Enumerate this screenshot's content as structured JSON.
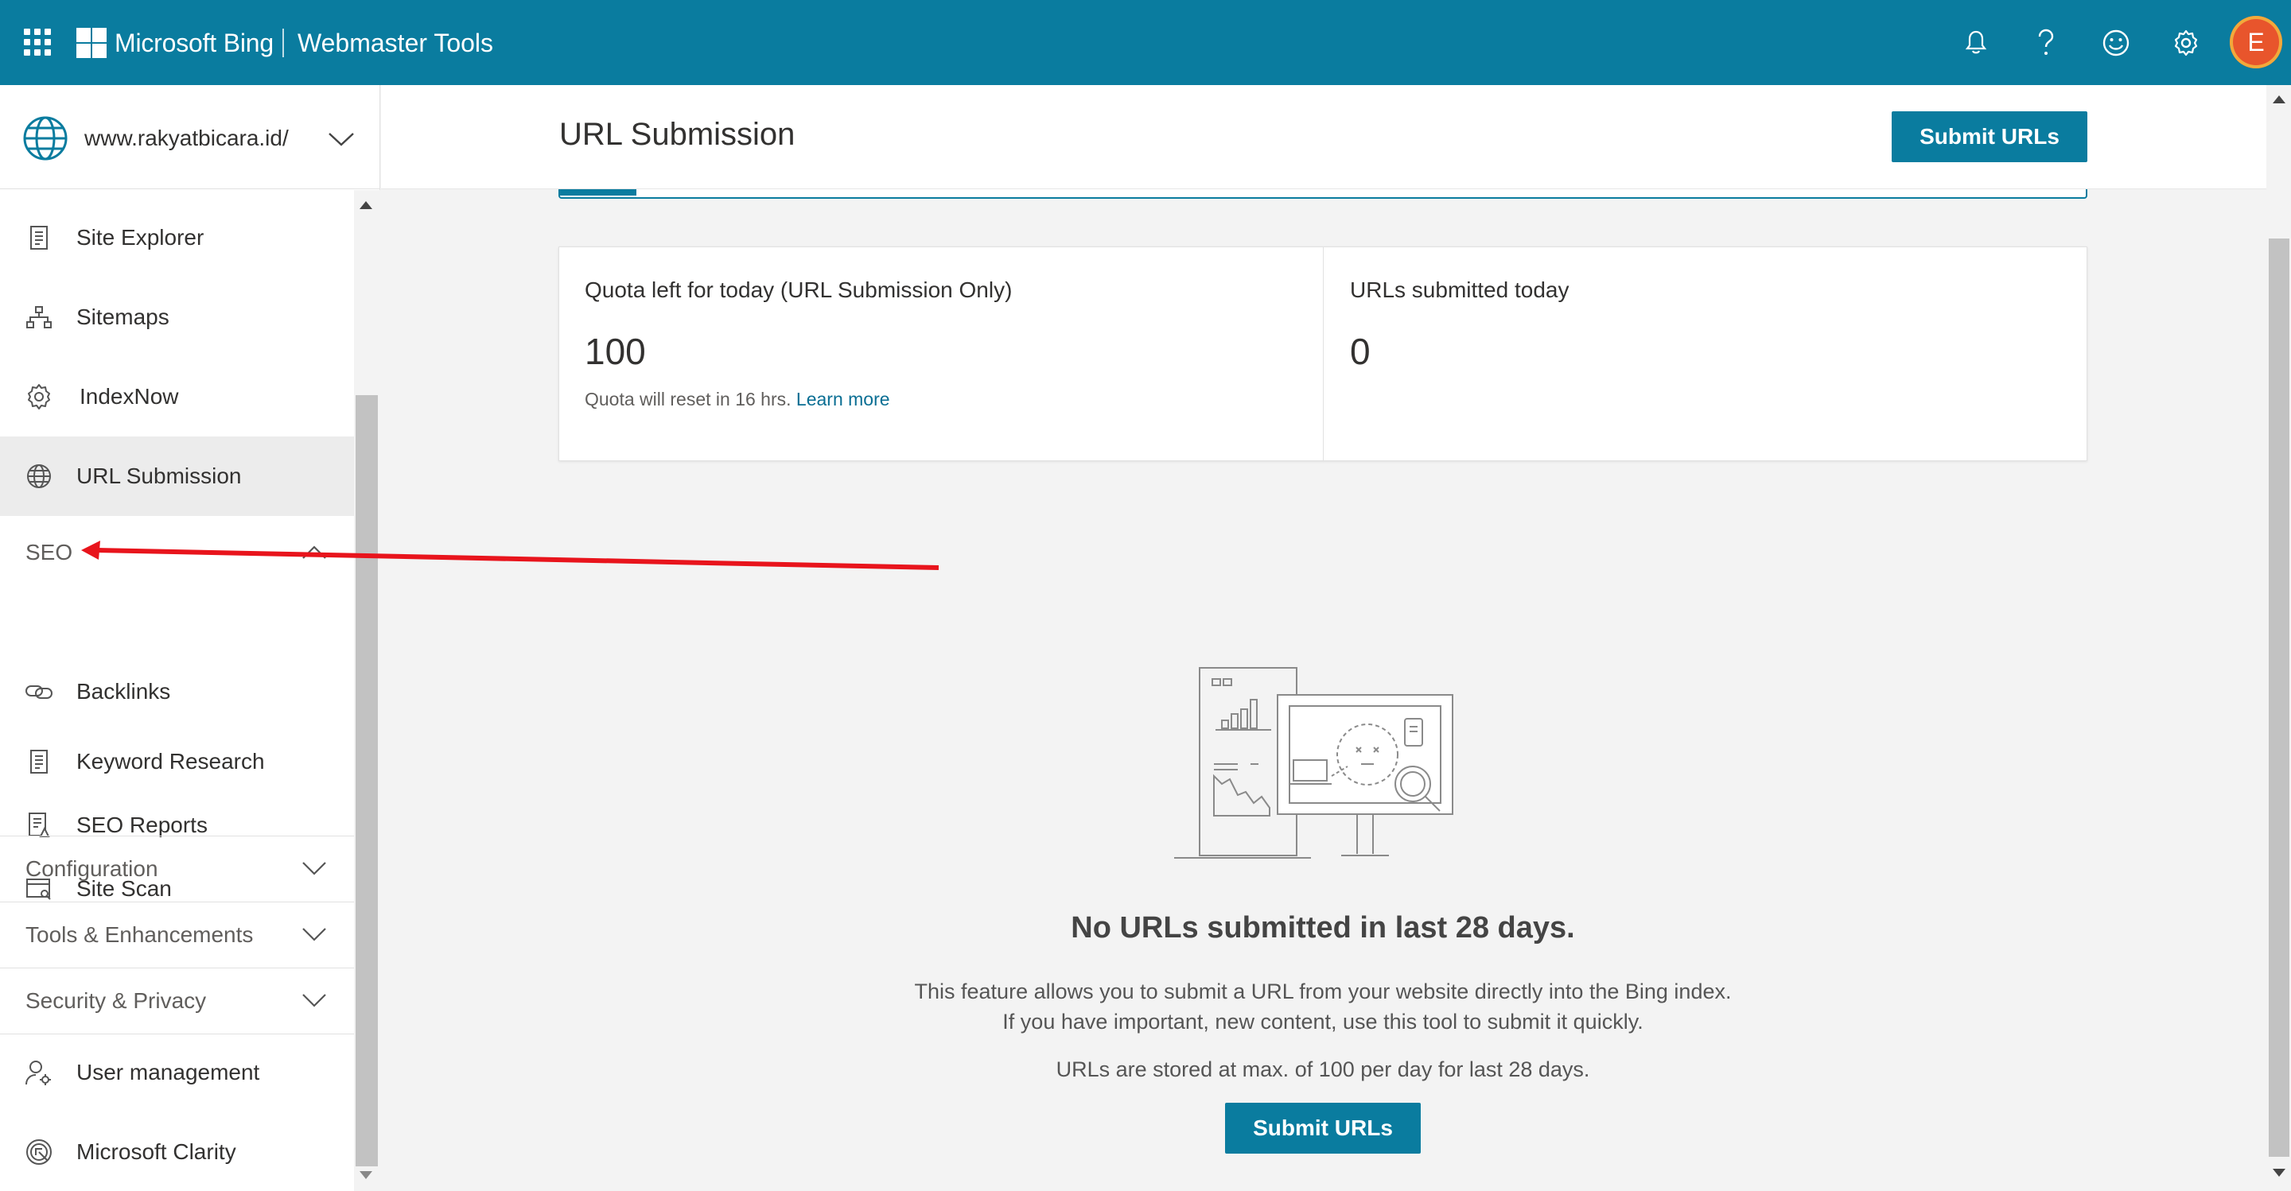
{
  "header": {
    "brand": "Microsoft Bing",
    "product": "Webmaster Tools",
    "avatar_initial": "E",
    "icons": [
      "notification-bell-icon",
      "help-icon",
      "feedback-smiley-icon",
      "settings-gear-icon"
    ],
    "bar_color": "#0a7c9f"
  },
  "site": {
    "url": "www.rakyatbicara.id/"
  },
  "nav": {
    "items_top": [
      {
        "label": "Site Explorer",
        "icon": "site-explorer-icon"
      },
      {
        "label": "Sitemaps",
        "icon": "sitemap-icon"
      },
      {
        "label": "IndexNow",
        "icon": "gear-icon"
      },
      {
        "label": "URL Submission",
        "icon": "globe-icon",
        "active": true
      }
    ],
    "seo_section": {
      "label": "SEO",
      "items": [
        {
          "label": "Backlinks",
          "icon": "link-icon"
        },
        {
          "label": "Keyword Research",
          "icon": "document-icon"
        },
        {
          "label": "SEO Reports",
          "icon": "report-icon"
        },
        {
          "label": "Site Scan",
          "icon": "site-scan-icon"
        }
      ]
    },
    "collapsed_sections": [
      {
        "label": "Configuration"
      },
      {
        "label": "Tools & Enhancements"
      },
      {
        "label": "Security & Privacy"
      }
    ],
    "items_bottom": [
      {
        "label": "User management",
        "icon": "user-management-icon"
      },
      {
        "label": "Microsoft Clarity",
        "icon": "clarity-icon"
      }
    ]
  },
  "main": {
    "title": "URL Submission",
    "submit_button": "Submit URLs",
    "quota_card": {
      "label": "Quota left for today (URL Submission Only)",
      "value": "100",
      "note": "Quota will reset in 16 hrs.",
      "link": "Learn more"
    },
    "submitted_card": {
      "label": "URLs submitted today",
      "value": "0"
    },
    "empty_state": {
      "title": "No URLs submitted in last 28 days.",
      "line1": "This feature allows you to submit a URL from your website directly into the Bing index.",
      "line2": "If you have important, new content, use this tool to submit it quickly.",
      "line3": "URLs are stored at max. of 100 per day for last 28 days.",
      "button": "Submit URLs"
    }
  },
  "annotation": {
    "type": "red-arrow",
    "points_to": "SEO",
    "color": "#e8141c"
  }
}
